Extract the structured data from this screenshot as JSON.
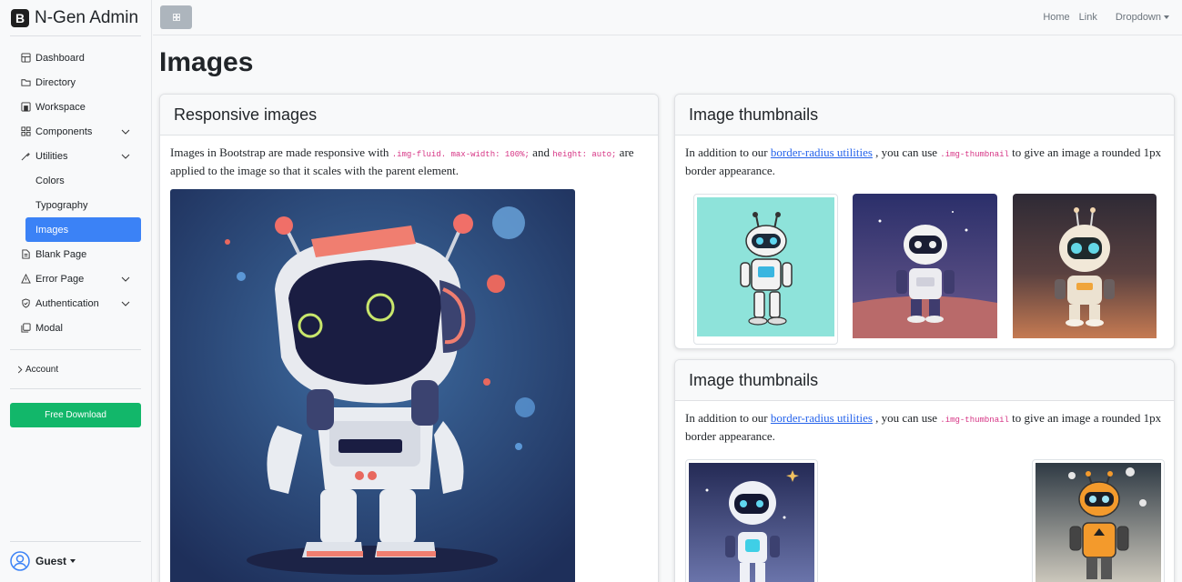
{
  "brand": {
    "logo_letter": "B",
    "name": "N-Gen Admin"
  },
  "sidebar": {
    "items": [
      {
        "label": "Dashboard",
        "icon": "dashboard-icon"
      },
      {
        "label": "Directory",
        "icon": "folder-icon"
      },
      {
        "label": "Workspace",
        "icon": "workspace-icon"
      },
      {
        "label": "Components",
        "icon": "components-icon",
        "has_chevron": true
      },
      {
        "label": "Utilities",
        "icon": "tools-icon",
        "has_chevron": true
      },
      {
        "label": "Blank Page",
        "icon": "file-icon"
      },
      {
        "label": "Error Page",
        "icon": "warning-icon",
        "has_chevron": true
      },
      {
        "label": "Authentication",
        "icon": "shield-icon",
        "has_chevron": true
      },
      {
        "label": "Modal",
        "icon": "copy-icon"
      }
    ],
    "utilities_sub": [
      "Colors",
      "Typography",
      "Images"
    ],
    "active_sub": "Images",
    "account_label": "Account",
    "download_label": "Free Download",
    "user_label": "Guest"
  },
  "topnav": {
    "home": "Home",
    "link": "Link",
    "dropdown": "Dropdown"
  },
  "page_title": "Images",
  "cards": {
    "responsive": {
      "title": "Responsive images",
      "text_1": "Images in Bootstrap are made responsive with",
      "code_1": ".img-fluid",
      "code_2": ". max-width: 100%;",
      "text_2": "and",
      "code_3": "height: auto;",
      "text_3": "are applied to the image so that it scales with the parent element."
    },
    "thumbs_1": {
      "title": "Image thumbnails",
      "text_1": "In addition to our",
      "link": "border-radius utilities",
      "text_2": ", you can use",
      "code": ".img-thumbnail",
      "text_3": "to give an image a rounded 1px border appearance."
    },
    "thumbs_2": {
      "title": "Image thumbnails",
      "text_1": "In addition to our",
      "link": "border-radius utilities",
      "text_2": ", you can use",
      "code": ".img-thumbnail",
      "text_3": "to give an image a rounded 1px border appearance."
    }
  },
  "colors": {
    "accent": "#3b82f6",
    "download": "#12b76a",
    "code": "#d63384",
    "link": "#2563eb"
  }
}
